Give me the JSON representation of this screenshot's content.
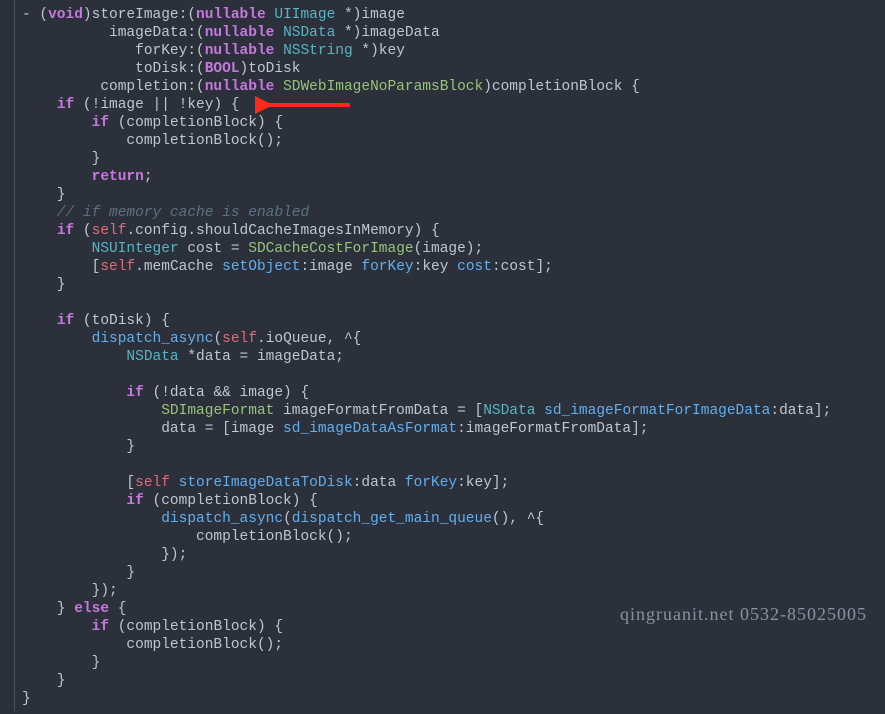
{
  "watermark": "qingruanit.net 0532-85025005",
  "code": {
    "line1": {
      "a": "- (",
      "void": "void",
      "b": ")storeImage:(",
      "nullable": "nullable",
      "sp": " ",
      "UIImage": "UIImage",
      "c": " *)image"
    },
    "line2": {
      "a": "          imageData:(",
      "nullable": "nullable",
      "sp": " ",
      "NSData": "NSData",
      "b": " *)imageData"
    },
    "line3": {
      "a": "             forKey:(",
      "nullable": "nullable",
      "sp": " ",
      "NSString": "NSString",
      "b": " *)key"
    },
    "line4": {
      "a": "             toDisk:(",
      "BOOL": "BOOL",
      "b": ")toDisk"
    },
    "line5": {
      "a": "         completion:(",
      "nullable": "nullable",
      "sp": " ",
      "SDWebImageNoParamsBlock": "SDWebImageNoParamsBlock",
      "b": ")completionBlock {"
    },
    "line6": {
      "if": "if",
      "a": " (!image || !key) {"
    },
    "line7": {
      "if": "if",
      "a": " (completionBlock) {"
    },
    "line8": "            completionBlock();",
    "line9": "        }",
    "line10": {
      "return": "return",
      "a": ";"
    },
    "line11": "    }",
    "line12": "    // if memory cache is enabled",
    "line13": {
      "if": "if",
      "a": " (",
      "self": "self",
      "b": ".config.shouldCacheImagesInMemory) {"
    },
    "line14": {
      "NSUInteger": "NSUInteger",
      "a": " cost = ",
      "fn": "SDCacheCostForImage",
      "b": "(image);"
    },
    "line15": {
      "a": "        [",
      "self": "self",
      "b": ".memCache ",
      "setObject": "setObject",
      "c": ":image ",
      "forKey": "forKey",
      "d": ":key ",
      "cost": "cost",
      "e": ":cost];"
    },
    "line16": "    }",
    "line17": "",
    "line18": {
      "if": "if",
      "a": " (toDisk) {"
    },
    "line19": {
      "a": "        ",
      "fn": "dispatch_async",
      "b": "(",
      "self": "self",
      "c": ".ioQueue, ^{"
    },
    "line20": {
      "a": "            ",
      "NSData": "NSData",
      "b": " *data = imageData;"
    },
    "line21": "",
    "line22": {
      "if": "if",
      "a": " (!data && image) {"
    },
    "line23": {
      "a": "                ",
      "SDImageFormat": "SDImageFormat",
      "b": " imageFormatFromData = [",
      "NSData": "NSData",
      "c": " ",
      "sel": "sd_imageFormatForImageData",
      "d": ":data];"
    },
    "line24": {
      "a": "                data = [image ",
      "sel": "sd_imageDataAsFormat",
      "b": ":imageFormatFromData];"
    },
    "line25": "            }",
    "line26": "",
    "line27": {
      "a": "            [",
      "self": "self",
      "b": " ",
      "sel1": "storeImageDataToDisk",
      "c": ":data ",
      "sel2": "forKey",
      "d": ":key];"
    },
    "line28": {
      "if": "if",
      "a": " (completionBlock) {"
    },
    "line29": {
      "a": "                ",
      "fn": "dispatch_async",
      "b": "(",
      "q": "dispatch_get_main_queue",
      "c": "(), ^{"
    },
    "line30": "                    completionBlock();",
    "line31": "                });",
    "line32": "            }",
    "line33": "        });",
    "line34": {
      "a": "    } ",
      "else": "else",
      "b": " {"
    },
    "line35": {
      "if": "if",
      "a": " (completionBlock) {"
    },
    "line36": "            completionBlock();",
    "line37": "        }",
    "line38": "    }",
    "line39": "}"
  }
}
